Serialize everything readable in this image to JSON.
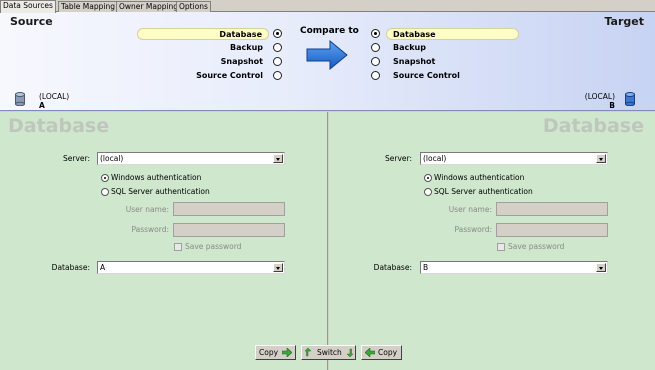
{
  "tabs": [
    {
      "label": "Data Sources",
      "active": true
    },
    {
      "label": "Table Mapping",
      "active": false
    },
    {
      "label": "Owner Mapping",
      "active": false
    },
    {
      "label": "Options",
      "active": false
    }
  ],
  "header": {
    "source_title": "Source",
    "target_title": "Target",
    "compare_label": "Compare to",
    "source_options": [
      {
        "label": "Database",
        "selected": true
      },
      {
        "label": "Backup",
        "selected": false
      },
      {
        "label": "Snapshot",
        "selected": false
      },
      {
        "label": "Source Control",
        "selected": false
      }
    ],
    "target_options": [
      {
        "label": "Database",
        "selected": true
      },
      {
        "label": "Backup",
        "selected": false
      },
      {
        "label": "Snapshot",
        "selected": false
      },
      {
        "label": "Source Control",
        "selected": false
      }
    ],
    "source_server": "(LOCAL)",
    "source_db": "A",
    "target_server": "(LOCAL)",
    "target_db": "B"
  },
  "left_panel": {
    "title": "Database",
    "server_label": "Server:",
    "server_value": "(local)",
    "win_auth": "Windows authentication",
    "sql_auth": "SQL Server authentication",
    "auth_selected": "windows",
    "username_label": "User name:",
    "password_label": "Password:",
    "save_password": "Save password",
    "database_label": "Database:",
    "database_value": "A"
  },
  "right_panel": {
    "title": "Database",
    "server_label": "Server:",
    "server_value": "(local)",
    "win_auth": "Windows authentication",
    "sql_auth": "SQL Server authentication",
    "auth_selected": "windows",
    "username_label": "User name:",
    "password_label": "Password:",
    "save_password": "Save password",
    "database_label": "Database:",
    "database_value": "B"
  },
  "buttons": {
    "copy_right": "Copy",
    "switch": "Switch",
    "copy_left": "Copy"
  },
  "colors": {
    "panel_bg": "#cfe7cc",
    "highlight": "#fffdc6",
    "arrow": "#1f6fd6"
  }
}
